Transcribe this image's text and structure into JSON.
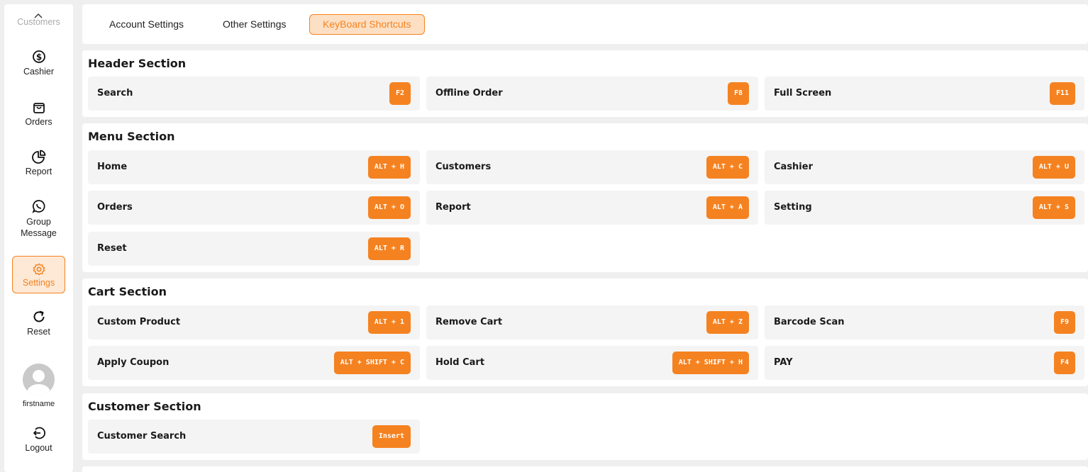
{
  "sidebar": {
    "customers_partial": "Customers",
    "items": [
      {
        "label": "Cashier",
        "icon": "dollar-icon"
      },
      {
        "label": "Orders",
        "icon": "bag-icon"
      },
      {
        "label": "Report",
        "icon": "pie-chart-icon"
      },
      {
        "label": "Group\nMessage",
        "icon": "whatsapp-icon"
      },
      {
        "label": "Settings",
        "icon": "gear-icon"
      },
      {
        "label": "Reset",
        "icon": "refresh-icon"
      }
    ],
    "username": "firstname",
    "logout_label": "Logout"
  },
  "tabs": [
    "Account Settings",
    "Other Settings",
    "KeyBoard Shortcuts"
  ],
  "active_tab": "KeyBoard Shortcuts",
  "accent_color": "#f58220",
  "sections": {
    "header": {
      "title": "Header Section",
      "shortcuts": [
        {
          "label": "Search",
          "key": "F2"
        },
        {
          "label": "Offline Order",
          "key": "F8"
        },
        {
          "label": "Full Screen",
          "key": "F11"
        }
      ]
    },
    "menu": {
      "title": "Menu Section",
      "shortcuts": [
        {
          "label": "Home",
          "key": "ALT + H"
        },
        {
          "label": "Customers",
          "key": "ALT + C"
        },
        {
          "label": "Cashier",
          "key": "ALT + U"
        },
        {
          "label": "Orders",
          "key": "ALT + O"
        },
        {
          "label": "Report",
          "key": "ALT + A"
        },
        {
          "label": "Setting",
          "key": "ALT + S"
        },
        {
          "label": "Reset",
          "key": "ALT + R"
        }
      ]
    },
    "cart": {
      "title": "Cart Section",
      "shortcuts": [
        {
          "label": "Custom Product",
          "key": "ALT + 1"
        },
        {
          "label": "Remove Cart",
          "key": "ALT + Z"
        },
        {
          "label": "Barcode Scan",
          "key": "F9"
        },
        {
          "label": "Apply Coupon",
          "key": "ALT + SHIFT + C"
        },
        {
          "label": "Hold Cart",
          "key": "ALT + SHIFT + H"
        },
        {
          "label": "PAY",
          "key": "F4"
        }
      ]
    },
    "customer": {
      "title": "Customer Section",
      "shortcuts": [
        {
          "label": "Customer Search",
          "key": "Insert"
        }
      ]
    }
  }
}
